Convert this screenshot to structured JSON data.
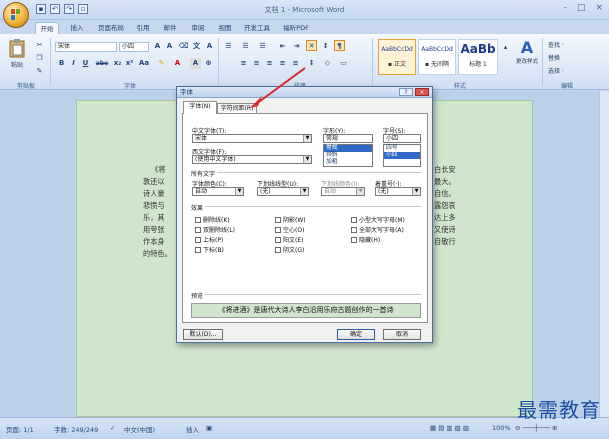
{
  "window": {
    "title": "文档 1 - Microsoft Word",
    "controls": [
      "-",
      "□",
      "×"
    ]
  },
  "ribbon_tabs": [
    "开始",
    "插入",
    "页面布局",
    "引用",
    "邮件",
    "审阅",
    "视图",
    "开发工具",
    "福昕PDF"
  ],
  "ribbon": {
    "paste_label": "粘贴",
    "font_name": "宋体",
    "font_size": "小四",
    "format_buttons": [
      "B",
      "I",
      "U",
      "abe",
      "x₂",
      "x²",
      "Aa"
    ],
    "styles": [
      {
        "sample": "AaBbCcDd",
        "name": "▪ 正文"
      },
      {
        "sample": "AaBbCcDd",
        "name": "▪ 无间隔"
      },
      {
        "sample": "AaBb",
        "name": "标题 1"
      }
    ],
    "change_styles": "更改样式",
    "editing": [
      "查找 ·",
      "替换",
      "选择 ·"
    ],
    "group_labels": [
      "剪贴板",
      "字体",
      "段落",
      "样式",
      "编辑"
    ]
  },
  "document": {
    "left_lines": [
      "《将",
      "敦还以",
      "诗人豪",
      "悲愤与",
      "乐，其",
      "用夸张",
      "作本身",
      "的特色。"
    ],
    "right_lines": [
      "白长安",
      "最大。",
      "自信。",
      "露怨哀",
      "达上多",
      "又使诗",
      "自敬行"
    ]
  },
  "dialog": {
    "title": "字体",
    "title_buttons": [
      "?",
      "×"
    ],
    "tabs": [
      "字体(N)",
      "字符间距(R)"
    ],
    "labels": {
      "cn_font": "中文字体(T):",
      "latin_font": "西文字体(F):",
      "style": "字形(Y):",
      "size": "字号(S):",
      "all_text": "所有文字",
      "font_color": "字体颜色(C):",
      "underline_style": "下划线线型(U):",
      "underline_color": "下划线颜色(I):",
      "emphasis": "着重号(·):",
      "effects": "效果",
      "preview": "预览"
    },
    "values": {
      "cn_font": "宋体",
      "latin_font": "(使用中文字体)",
      "style": "常规",
      "size": "小四",
      "font_color": "自动",
      "underline_style": "(无)",
      "underline_color": "自动",
      "emphasis": "(无)"
    },
    "style_list": [
      "常规",
      "倾斜",
      "加粗"
    ],
    "size_list": [
      "四号",
      "小四"
    ],
    "effects_col1": [
      "删除线(K)",
      "双删除线(L)",
      "上标(P)",
      "下标(B)"
    ],
    "effects_col2": [
      "阴影(W)",
      "空心(O)",
      "阳文(E)",
      "阴文(G)"
    ],
    "effects_col3": [
      "小型大写字母(M)",
      "全部大写字母(A)",
      "隐藏(H)"
    ],
    "preview_text": "《将进酒》是唐代大诗人李白沿用乐府古题创作的一首诗",
    "buttons": {
      "default": "默认(D)...",
      "ok": "确定",
      "cancel": "取消"
    }
  },
  "status": {
    "page": "页面: 1/1",
    "words": "字数: 249/249",
    "language": "中文(中国)",
    "mode": "插入",
    "zoom": "100%"
  },
  "watermark": "最需教育"
}
